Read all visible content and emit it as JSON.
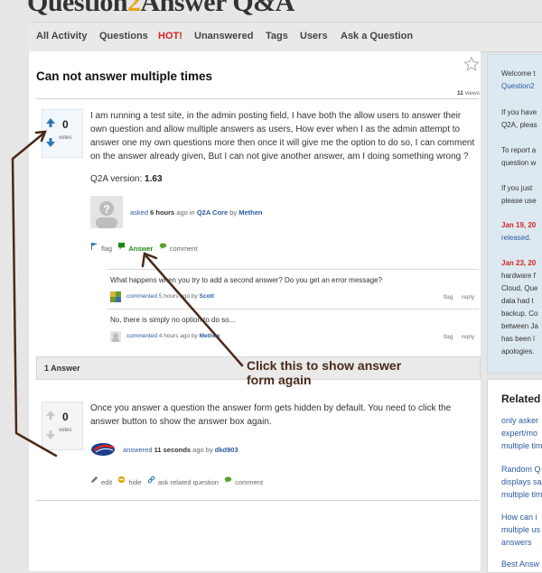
{
  "header": {
    "logo_text": "Question",
    "logo_text2": "Answer",
    "logo_qa": "Q&A"
  },
  "nav": {
    "items": [
      "All Activity",
      "Questions",
      "HOT!",
      "Unanswered",
      "Tags",
      "Users",
      "Ask a Question"
    ]
  },
  "question": {
    "title": "Can not answer multiple times",
    "views_count": "11",
    "views_label": "views",
    "votes": "0",
    "votes_label": "votes",
    "text": "I am running a test site, in the admin posting field, I have both the allow users to answer their own question and allow multiple answers as users, How ever when I as the admin attempt to answer one my own questions more then once it will give me the option to do so, I can comment on the answer already given, But I can not give another answer, am I doing something wrong ?",
    "version_label": "Q2A version:",
    "version_value": "1.63",
    "meta": {
      "asked": "asked",
      "time": "6 hours",
      "ago_in": "ago in",
      "category": "Q2A Core",
      "by": "by",
      "user": "Methen"
    },
    "actions": {
      "flag": "flag",
      "answer": "Answer",
      "comment": "comment"
    }
  },
  "comments": [
    {
      "text": "What happens when you try to add a second answer? Do you get an error message?",
      "commented": "commented",
      "time": "5 hours",
      "ago": "ago by",
      "user": "Scott",
      "flag": "flag",
      "reply": "reply"
    },
    {
      "text": "No, there is simply no option to do so...",
      "commented": "commented",
      "time": "4 hours",
      "ago": "ago by",
      "user": "Methen",
      "flag": "flag",
      "reply": "reply"
    }
  ],
  "answers_header": "1 Answer",
  "answer": {
    "votes": "0",
    "votes_label": "votes",
    "text": "Once you answer a question the answer form gets hidden by default. You need to click the answer button to show the answer box again.",
    "meta": {
      "answered": "answered",
      "time": "11 seconds",
      "ago": "ago by",
      "user": "dkd903"
    },
    "actions": {
      "edit": "edit",
      "hide": "hide",
      "ask_related": "ask related question",
      "comment": "comment"
    }
  },
  "annotation": {
    "line1": "Click this to show answer",
    "line2": "form again"
  },
  "sidebar": {
    "lines": [
      {
        "text": "Welcome t",
        "style": "plain"
      },
      {
        "text": "Question2",
        "style": "link"
      },
      {
        "text": "If you have",
        "style": "plain"
      },
      {
        "text": "Q2A, pleas",
        "style": "plain"
      },
      {
        "text": "To report a",
        "style": "plain"
      },
      {
        "text": "question w",
        "style": "plain"
      },
      {
        "text": "If you just",
        "style": "plain"
      },
      {
        "text": "please use",
        "style": "plain"
      },
      {
        "text": "Jan 19, 20",
        "style": "red"
      },
      {
        "text": "released.",
        "style": "link"
      },
      {
        "text": "Jan 23, 20",
        "style": "red"
      },
      {
        "text": "hardware f",
        "style": "plain"
      },
      {
        "text": "Cloud, Que",
        "style": "plain"
      },
      {
        "text": "data had t",
        "style": "plain"
      },
      {
        "text": "backup. Co",
        "style": "plain"
      },
      {
        "text": "between Ja",
        "style": "plain"
      },
      {
        "text": "has been l",
        "style": "plain"
      },
      {
        "text": "apologies.",
        "style": "plain"
      }
    ]
  },
  "related": {
    "title": "Related",
    "lines": [
      "only asker",
      "expert/mo",
      "multiple tim",
      "Random Q",
      "displays sa",
      "multiple tim",
      "How can i",
      "multiple us",
      "answers",
      "Best Answ"
    ]
  },
  "colors": {
    "link": "#2c5aa0",
    "hot": "#d52424",
    "answer_green": "#1f8a12",
    "vote_arrow": "#2a78b8",
    "annotation": "#4a2a1a"
  }
}
